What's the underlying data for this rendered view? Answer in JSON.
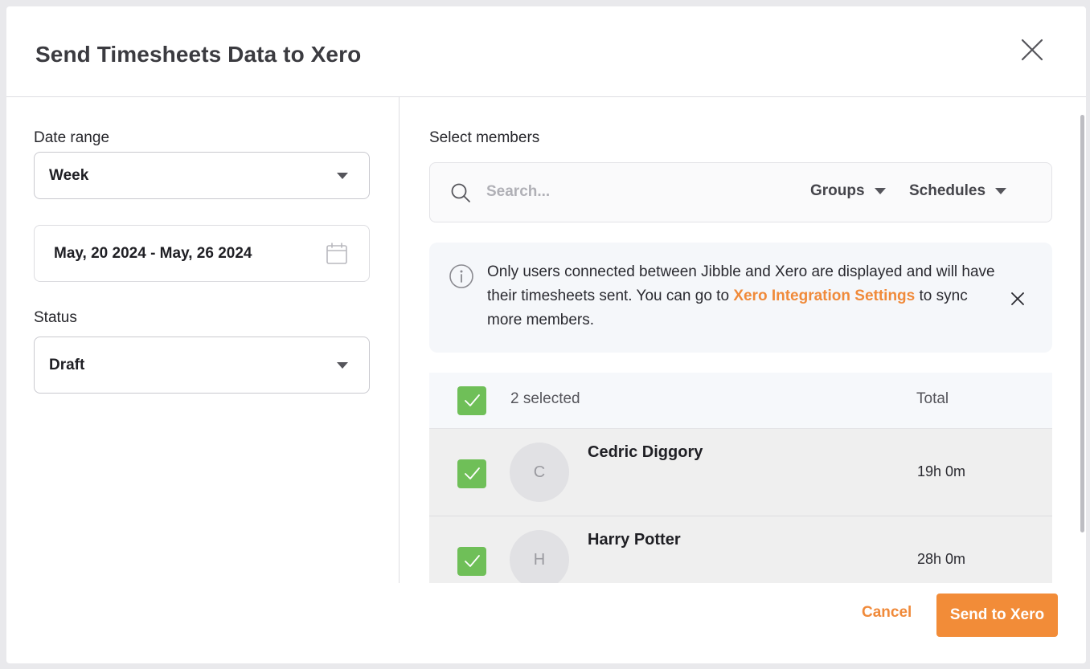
{
  "dialog": {
    "title": "Send Timesheets Data to Xero",
    "close_icon": "close-icon"
  },
  "left": {
    "date_range_label": "Date range",
    "date_range_value": "Week",
    "date_value": "May, 20 2024 - May, 26 2024",
    "status_label": "Status",
    "status_value": "Draft"
  },
  "right": {
    "select_members_label": "Select members",
    "search_placeholder": "Search...",
    "groups_label": "Groups",
    "schedules_label": "Schedules",
    "info": {
      "text_before": "Only users connected between Jibble and Xero are displayed and will have their timesheets sent. You can go to ",
      "link": "Xero Integration Settings",
      "text_after": " to sync more members."
    },
    "table": {
      "selected_count": "2 selected",
      "total_header": "Total",
      "rows": [
        {
          "initial": "C",
          "name": "Cedric Diggory",
          "total": "19h 0m",
          "checked": true
        },
        {
          "initial": "H",
          "name": "Harry Potter",
          "total": "28h 0m",
          "checked": true
        }
      ]
    }
  },
  "footer": {
    "cancel_label": "Cancel",
    "send_label": "Send to Xero"
  },
  "colors": {
    "accent": "#f28c38",
    "checkbox_green": "#6fbf58",
    "info_bg": "#f5f7fa"
  }
}
